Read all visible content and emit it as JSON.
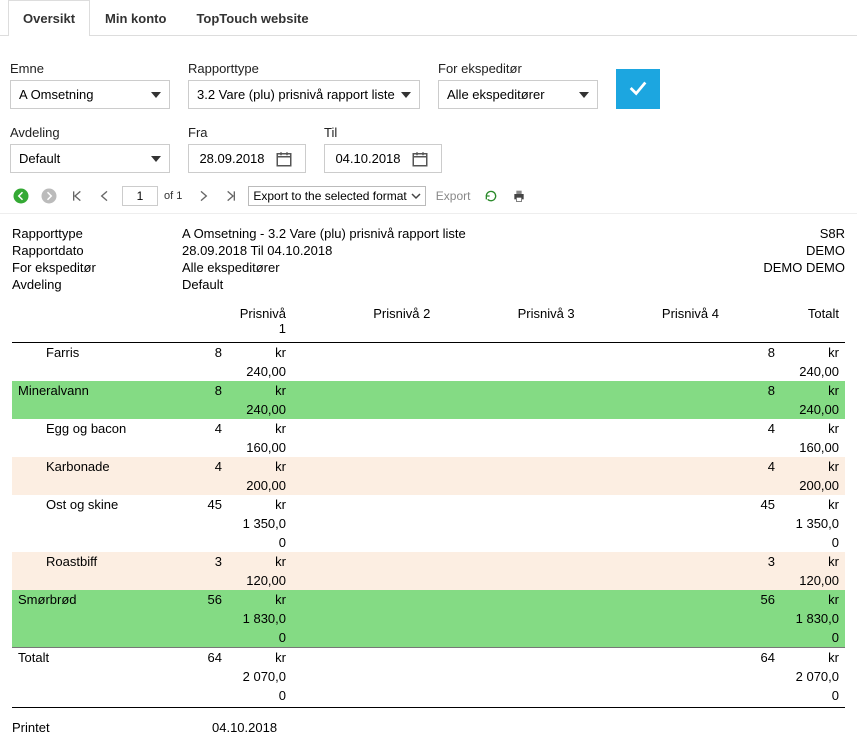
{
  "tabs": {
    "oversikt": "Oversikt",
    "min_konto": "Min konto",
    "toptouch": "TopTouch website"
  },
  "filters": {
    "emne": {
      "label": "Emne",
      "value": "A Omsetning"
    },
    "rapporttype": {
      "label": "Rapporttype",
      "value": "3.2 Vare (plu) prisnivå rapport liste"
    },
    "ekspeditor": {
      "label": "For ekspeditør",
      "value": "Alle ekspeditører"
    },
    "avdeling": {
      "label": "Avdeling",
      "value": "Default"
    },
    "fra": {
      "label": "Fra",
      "value": "28.09.2018"
    },
    "til": {
      "label": "Til",
      "value": "04.10.2018"
    }
  },
  "toolbar": {
    "page": "1",
    "of": "of 1",
    "export_select": "Export to the selected format",
    "export": "Export"
  },
  "report_meta": {
    "rapporttype_label": "Rapporttype",
    "rapporttype_value": "A Omsetning - 3.2 Vare (plu) prisnivå rapport liste",
    "s8r": "S8R",
    "rapportdato_label": "Rapportdato",
    "rapportdato_value": "28.09.2018 Til 04.10.2018",
    "demo": "DEMO",
    "ekspeditor_label": "For ekspeditør",
    "ekspeditor_value": "Alle ekspeditører",
    "demo_demo": "DEMO DEMO",
    "avdeling_label": "Avdeling",
    "avdeling_value": "Default"
  },
  "columns": {
    "blank": "",
    "p1": "Prisnivå 1",
    "p2": "Prisnivå 2",
    "p3": "Prisnivå 3",
    "p4": "Prisnivå 4",
    "totalt": "Totalt"
  },
  "rows": [
    {
      "name": "Farris",
      "indent": true,
      "style": "",
      "q1": "8",
      "a1l1": "kr",
      "a1l2": "240,00",
      "a1l3": "",
      "qt": "8",
      "atl1": "kr",
      "atl2": "240,00",
      "atl3": ""
    },
    {
      "name": "Mineralvann",
      "indent": false,
      "style": "green",
      "q1": "8",
      "a1l1": "kr",
      "a1l2": "240,00",
      "a1l3": "",
      "qt": "8",
      "atl1": "kr",
      "atl2": "240,00",
      "atl3": ""
    },
    {
      "name": "Egg og bacon",
      "indent": true,
      "style": "",
      "q1": "4",
      "a1l1": "kr",
      "a1l2": "160,00",
      "a1l3": "",
      "qt": "4",
      "atl1": "kr",
      "atl2": "160,00",
      "atl3": ""
    },
    {
      "name": "Karbonade",
      "indent": true,
      "style": "beige",
      "q1": "4",
      "a1l1": "kr",
      "a1l2": "200,00",
      "a1l3": "",
      "qt": "4",
      "atl1": "kr",
      "atl2": "200,00",
      "atl3": ""
    },
    {
      "name": "Ost og skine",
      "indent": true,
      "style": "",
      "q1": "45",
      "a1l1": "kr",
      "a1l2": "1 350,0",
      "a1l3": "0",
      "qt": "45",
      "atl1": "kr",
      "atl2": "1 350,0",
      "atl3": "0"
    },
    {
      "name": "Roastbiff",
      "indent": true,
      "style": "beige",
      "q1": "3",
      "a1l1": "kr",
      "a1l2": "120,00",
      "a1l3": "",
      "qt": "3",
      "atl1": "kr",
      "atl2": "120,00",
      "atl3": ""
    },
    {
      "name": "Smørbrød",
      "indent": false,
      "style": "green",
      "q1": "56",
      "a1l1": "kr",
      "a1l2": "1 830,0",
      "a1l3": "0",
      "qt": "56",
      "atl1": "kr",
      "atl2": "1 830,0",
      "atl3": "0"
    },
    {
      "name": "Totalt",
      "indent": false,
      "style": "total",
      "q1": "64",
      "a1l1": "kr",
      "a1l2": "2 070,0",
      "a1l3": "0",
      "qt": "64",
      "atl1": "kr",
      "atl2": "2 070,0",
      "atl3": "0"
    }
  ],
  "printet": {
    "label": "Printet",
    "value": "04.10.2018"
  }
}
